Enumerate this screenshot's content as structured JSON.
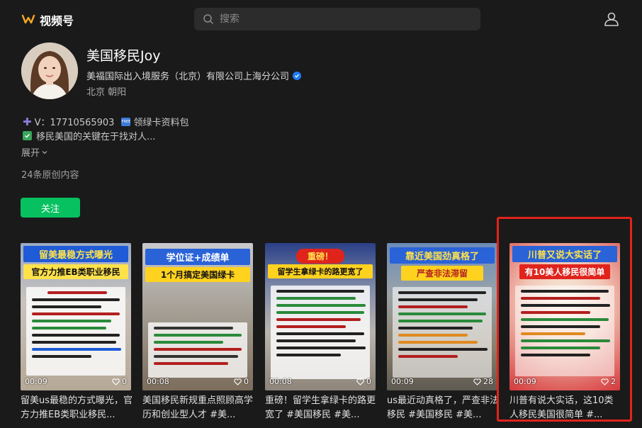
{
  "app": {
    "title": "视频号"
  },
  "search": {
    "placeholder": "搜索"
  },
  "profile": {
    "name": "美国移民Joy",
    "company": "美福国际出入境服务（北京）有限公司上海分公司",
    "location": "北京 朝阳",
    "bio_line1": "V：17710565903",
    "bio_line1_suffix": "领绿卡资料包",
    "bio_line2": "移民美国的关键在于找对人...",
    "expand_label": "展开",
    "original_count": "24条原创内容",
    "follow_label": "关注"
  },
  "videos": [
    {
      "title_top": "留美最稳方式曝光",
      "title_sub": "官方力推EB类职业移民",
      "duration": "00:09",
      "likes": "0",
      "caption": "留美us最稳的方式曝光，官方力推EB类职业移民..."
    },
    {
      "title_top": "学位证+成绩单",
      "title_sub": "1个月搞定美国绿卡",
      "duration": "00:08",
      "likes": "0",
      "caption": "美国移民新规重点照顾高学历和创业型人才 #美..."
    },
    {
      "title_top": "重磅！",
      "title_sub": "留学生拿绿卡的路更宽了",
      "duration": "00:08",
      "likes": "0",
      "caption": "重磅！留学生拿绿卡的路更宽了 #美国移民 #美..."
    },
    {
      "title_top": "靠近美国劲真格了",
      "title_sub": "严查非法滞留",
      "duration": "00:09",
      "likes": "28",
      "caption": "us最近动真格了，严查非法移民 #美国移民 #美..."
    },
    {
      "title_top": "川普又说大实话了",
      "title_sub": "有10美人移民很简单",
      "duration": "00:09",
      "likes": "2",
      "caption": "川普有说大实话，这10类人移民美国很简单 #..."
    }
  ],
  "colors": {
    "background": "#1a1a1a",
    "accent_green": "#07c160",
    "highlight_red": "#e0241c",
    "verified_blue": "#1f7bf2"
  },
  "icons": {
    "logo": "wechat-channels-logo-icon",
    "search": "search-icon",
    "user": "user-icon",
    "verified": "verified-badge-icon",
    "chevron": "chevron-down-icon",
    "heart": "heart-icon"
  }
}
